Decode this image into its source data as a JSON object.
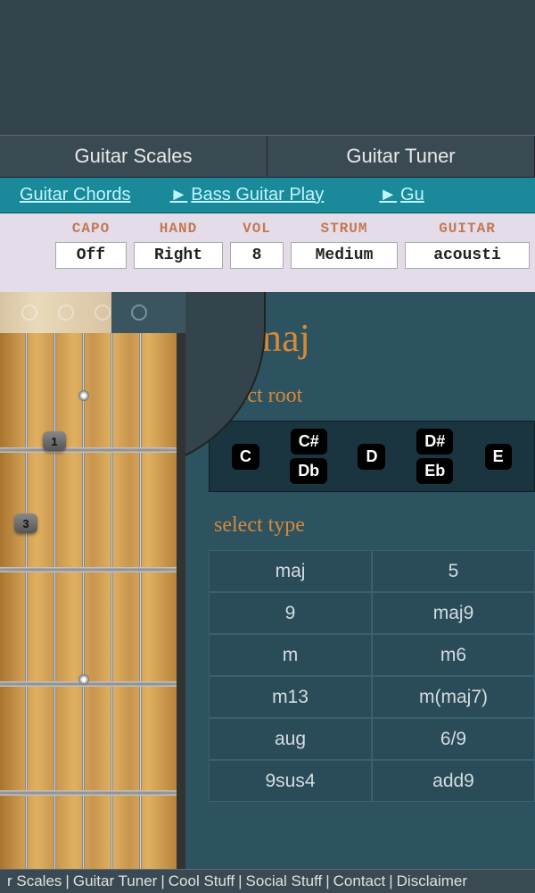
{
  "main_tabs": {
    "scales": "Guitar Scales",
    "tuner": "Guitar Tuner"
  },
  "sub_tabs": {
    "chords": "Guitar Chords",
    "bass_play": "Bass Guitar Play",
    "partial": "Gu"
  },
  "controls": {
    "capo": {
      "label": "CAPO",
      "value": "Off"
    },
    "hand": {
      "label": "HAND",
      "value": "Right"
    },
    "vol": {
      "label": "VOL",
      "value": "8"
    },
    "strum": {
      "label": "STRUM",
      "value": "Medium"
    },
    "guitar": {
      "label": "GUITAR",
      "value": "acousti"
    }
  },
  "fingers": {
    "f1": "1",
    "f3": "3"
  },
  "chord": {
    "name": "E maj",
    "root_label": "select root",
    "type_label": "select type",
    "roots": [
      {
        "top": "C",
        "bottom": null
      },
      {
        "top": "C#",
        "bottom": "Db"
      },
      {
        "top": "D",
        "bottom": null
      },
      {
        "top": "D#",
        "bottom": "Eb"
      },
      {
        "top": "E",
        "bottom": null
      }
    ],
    "types": [
      [
        "maj",
        "5"
      ],
      [
        "9",
        "maj9"
      ],
      [
        "m",
        "m6"
      ],
      [
        "m13",
        "m(maj7)"
      ],
      [
        "aug",
        "6/9"
      ],
      [
        "9sus4",
        "add9"
      ]
    ]
  },
  "footer": {
    "items": [
      "r Scales",
      "Guitar Tuner",
      "Cool Stuff",
      "Social Stuff",
      "Contact",
      "Disclaimer"
    ],
    "sep": " | "
  }
}
